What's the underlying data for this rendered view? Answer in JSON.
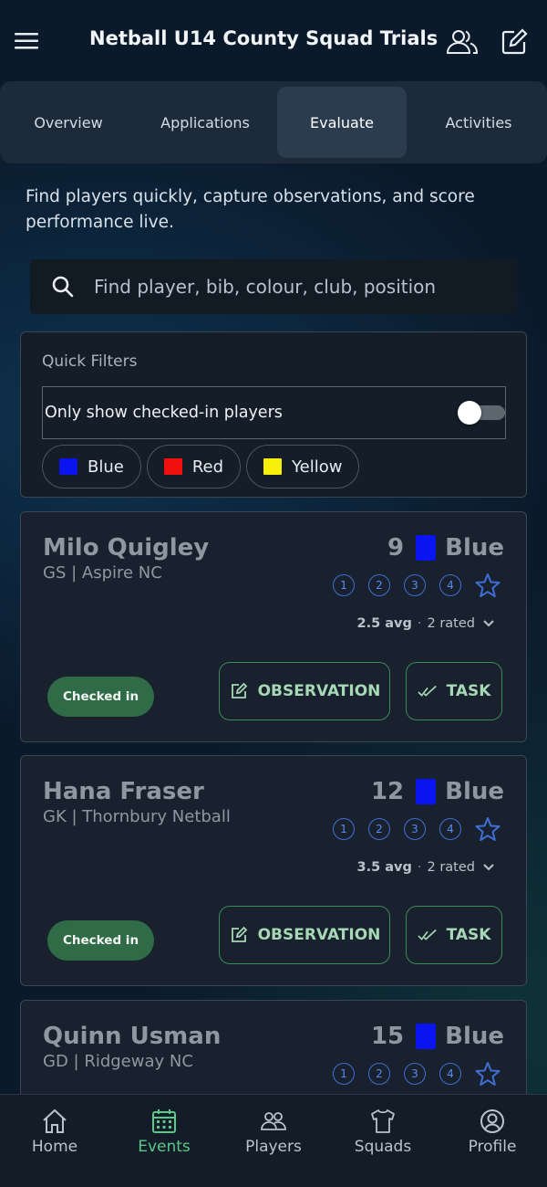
{
  "header": {
    "title": "Netball U14 County Squad Trials"
  },
  "tabs": [
    {
      "label": "Overview",
      "active": false
    },
    {
      "label": "Applications",
      "active": false
    },
    {
      "label": "Evaluate",
      "active": true
    },
    {
      "label": "Activities",
      "active": false
    }
  ],
  "intro": "Find players quickly, capture observations, and score performance live.",
  "search": {
    "placeholder": "Find player, bib, colour, club, position",
    "value": ""
  },
  "filters": {
    "title": "Quick Filters",
    "checked_in_only_label": "Only show checked-in players",
    "checked_in_only": false,
    "colours": [
      {
        "label": "Blue",
        "color": "#0a14f0"
      },
      {
        "label": "Red",
        "color": "#f01010"
      },
      {
        "label": "Yellow",
        "color": "#f5ef0a"
      }
    ]
  },
  "players": [
    {
      "name": "Milo Quigley",
      "sub": "GS | Aspire NC",
      "bib": "9",
      "team": "Blue",
      "team_color": "#0a14f0",
      "avg": "2.5 avg",
      "rated": "2 rated",
      "status": "Checked in"
    },
    {
      "name": "Hana Fraser",
      "sub": "GK | Thornbury Netball",
      "bib": "12",
      "team": "Blue",
      "team_color": "#0a14f0",
      "avg": "3.5 avg",
      "rated": "2 rated",
      "status": "Checked in"
    },
    {
      "name": "Quinn Usman",
      "sub": "GD | Ridgeway NC",
      "bib": "15",
      "team": "Blue",
      "team_color": "#0a14f0",
      "avg": "",
      "rated": "",
      "status": ""
    }
  ],
  "rating_options": [
    "1",
    "2",
    "3",
    "4"
  ],
  "actions": {
    "observation_label": "OBSERVATION",
    "task_label": "TASK"
  },
  "nav": [
    {
      "label": "Home",
      "icon": "home-icon",
      "active": false
    },
    {
      "label": "Events",
      "icon": "calendar-icon",
      "active": true
    },
    {
      "label": "Players",
      "icon": "players-icon",
      "active": false
    },
    {
      "label": "Squads",
      "icon": "shirt-icon",
      "active": false
    },
    {
      "label": "Profile",
      "icon": "profile-icon",
      "active": false
    }
  ],
  "colors": {
    "accent_green": "#59c98a",
    "rating_blue": "#3f6fd6"
  }
}
